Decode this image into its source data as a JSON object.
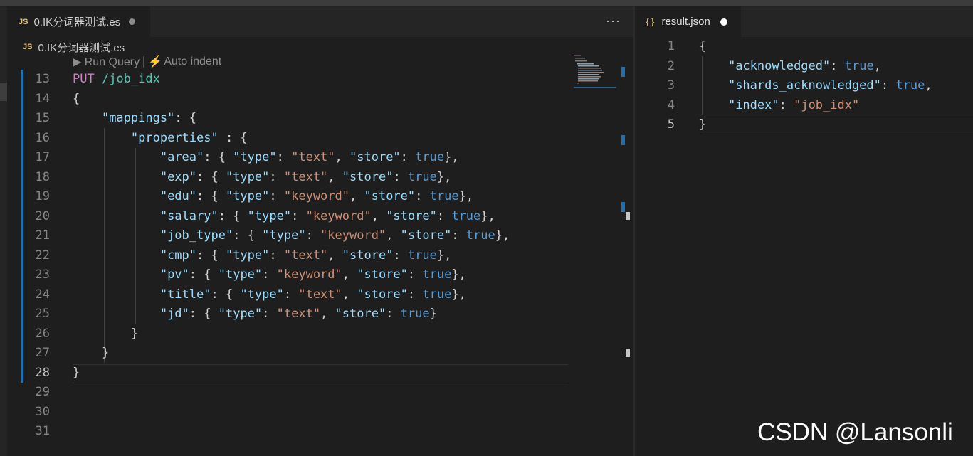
{
  "left_editor": {
    "tab": {
      "icon": "JS",
      "title": "0.IK分词器测试.es",
      "modified": true
    },
    "more_actions": "···",
    "breadcrumb": {
      "icon": "JS",
      "file": "0.IK分词器测试.es"
    },
    "codelens": {
      "run": "▶ Run Query",
      "separator": "|",
      "auto_indent": "Auto indent"
    },
    "line_numbers": [
      "13",
      "14",
      "15",
      "16",
      "17",
      "18",
      "19",
      "20",
      "21",
      "22",
      "23",
      "24",
      "25",
      "26",
      "27",
      "28",
      "29",
      "30",
      "31"
    ],
    "current_line": "28",
    "code": {
      "put_method": "PUT",
      "put_path": "/job_idx",
      "open_brace": "{",
      "mappings_key": "\"mappings\"",
      "properties_key": "\"properties\"",
      "fields": [
        {
          "name": "\"area\"",
          "type": "\"text\"",
          "store": "true"
        },
        {
          "name": "\"exp\"",
          "type": "\"text\"",
          "store": "true"
        },
        {
          "name": "\"edu\"",
          "type": "\"keyword\"",
          "store": "true"
        },
        {
          "name": "\"salary\"",
          "type": "\"keyword\"",
          "store": "true"
        },
        {
          "name": "\"job_type\"",
          "type": "\"keyword\"",
          "store": "true"
        },
        {
          "name": "\"cmp\"",
          "type": "\"text\"",
          "store": "true"
        },
        {
          "name": "\"pv\"",
          "type": "\"keyword\"",
          "store": "true"
        },
        {
          "name": "\"title\"",
          "type": "\"text\"",
          "store": "true"
        },
        {
          "name": "\"jd\"",
          "type": "\"text\"",
          "store": "true"
        }
      ],
      "type_key": "\"type\"",
      "store_key": "\"store\"",
      "close_inner": "}",
      "close_mid": "}",
      "close_outer": "}"
    }
  },
  "right_editor": {
    "tab": {
      "icon": "{}",
      "title": "result.json",
      "modified": true
    },
    "line_numbers": [
      "1",
      "2",
      "3",
      "4",
      "5"
    ],
    "current_line": "5",
    "json": {
      "open": "{",
      "entries": [
        {
          "key": "\"acknowledged\"",
          "value": "true",
          "kind": "bool",
          "comma": ","
        },
        {
          "key": "\"shards_acknowledged\"",
          "value": "true",
          "kind": "bool",
          "comma": ","
        },
        {
          "key": "\"index\"",
          "value": "\"job_idx\"",
          "kind": "string",
          "comma": ""
        }
      ],
      "close": "}"
    }
  },
  "watermark": "CSDN @Lansonli",
  "colors": {
    "editor_bg": "#1e1e1e",
    "tab_bar_bg": "#252526",
    "keyword": "#c586c0",
    "path": "#4ec9b0",
    "property": "#9cdcfe",
    "string": "#ce9178",
    "boolean": "#569cd6",
    "modified_bar": "#1f6fb5"
  }
}
